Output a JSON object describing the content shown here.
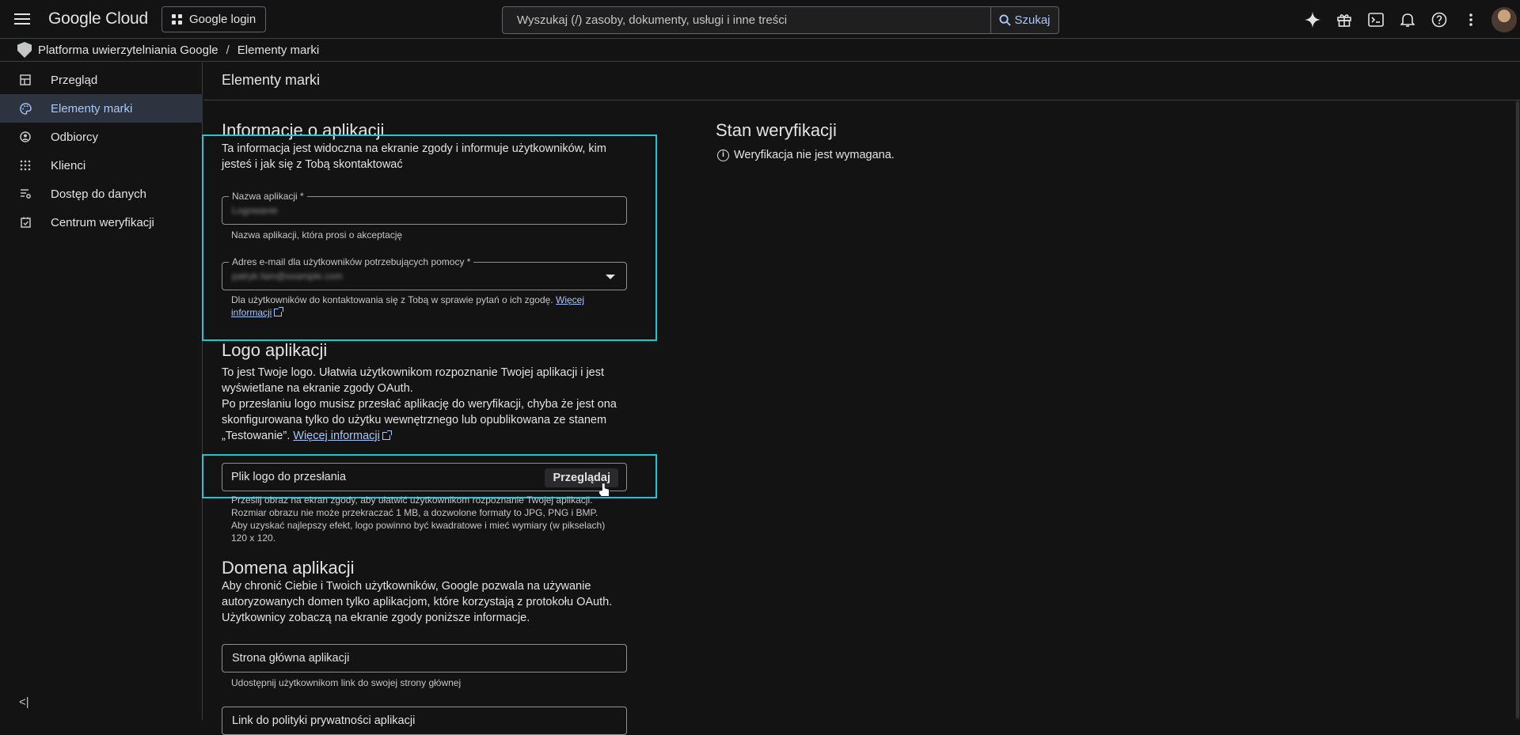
{
  "topbar": {
    "brand": "Google Cloud",
    "project": "Google login",
    "search_placeholder": "Wyszukaj (/) zasoby, dokumenty, usługi i inne treści",
    "search_button": "Szukaj",
    "icons": [
      "gemini-icon",
      "gift-icon",
      "cloud-shell-icon",
      "notifications-icon",
      "help-icon",
      "more-vert-icon",
      "avatar"
    ]
  },
  "breadcrumb": {
    "root": "Platforma uwierzytelniania Google",
    "separator": "/",
    "current": "Elementy marki"
  },
  "sidebar": {
    "items": [
      {
        "label": "Przegląd",
        "icon": "dashboard-icon"
      },
      {
        "label": "Elementy marki",
        "icon": "palette-icon"
      },
      {
        "label": "Odbiorcy",
        "icon": "person-icon"
      },
      {
        "label": "Klienci",
        "icon": "apps-grid-icon"
      },
      {
        "label": "Dostęp do danych",
        "icon": "data-settings-icon"
      },
      {
        "label": "Centrum weryfikacji",
        "icon": "verified-icon"
      }
    ],
    "active_index": 1,
    "collapse_label": "<|"
  },
  "page": {
    "title": "Elementy marki"
  },
  "app_info": {
    "heading": "Informacje o aplikacji",
    "description": "Ta informacja jest widoczna na ekranie zgody i informuje użytkowników, kim jesteś i jak się z Tobą skontaktować",
    "app_name_label": "Nazwa aplikacji *",
    "app_name_value": "Logowanie",
    "app_name_hint": "Nazwa aplikacji, która prosi o akceptację",
    "email_label": "Adres e-mail dla użytkowników potrzebujących pomocy *",
    "email_value": "patryk.fam@example.com",
    "email_hint": "Dla użytkowników do kontaktowania się z Tobą w sprawie pytań o ich zgodę.",
    "email_hint_link": "Więcej informacji"
  },
  "logo": {
    "heading": "Logo aplikacji",
    "description_1": "To jest Twoje logo. Ułatwia użytkownikom rozpoznanie Twojej aplikacji i jest wyświetlane na ekranie zgody OAuth.",
    "description_2": "Po przesłaniu logo musisz przesłać aplikację do weryfikacji, chyba że jest ona skonfigurowana tylko do użytku wewnętrznego lub opublikowana ze stanem „Testowanie”.",
    "more_link": "Więcej informacji",
    "upload_placeholder": "Plik logo do przesłania",
    "browse_button": "Przeglądaj",
    "hint_1": "Prześlij obraz na ekran zgody, aby ułatwić użytkownikom rozpoznanie Twojej aplikacji.",
    "hint_2": "Rozmiar obrazu nie może przekraczać 1 MB, a dozwolone formaty to JPG, PNG i BMP.",
    "hint_3": "Aby uzyskać najlepszy efekt, logo powinno być kwadratowe i mieć wymiary (w pikselach) 120 x 120."
  },
  "domain": {
    "heading": "Domena aplikacji",
    "description": "Aby chronić Ciebie i Twoich użytkowników, Google pozwala na używanie autoryzowanych domen tylko aplikacjom, które korzystają z protokołu OAuth. Użytkownicy zobaczą na ekranie zgody poniższe informacje.",
    "homepage_placeholder": "Strona główna aplikacji",
    "homepage_hint": "Udostępnij użytkownikom link do swojej strony głównej",
    "privacy_placeholder": "Link do polityki prywatności aplikacji"
  },
  "verification": {
    "heading": "Stan weryfikacji",
    "status": "Weryfikacja nie jest wymagana."
  },
  "colors": {
    "background": "#131314",
    "accent": "#a8c7fa",
    "highlight": "#1ec8d2",
    "active_nav_bg": "#2d3440"
  }
}
